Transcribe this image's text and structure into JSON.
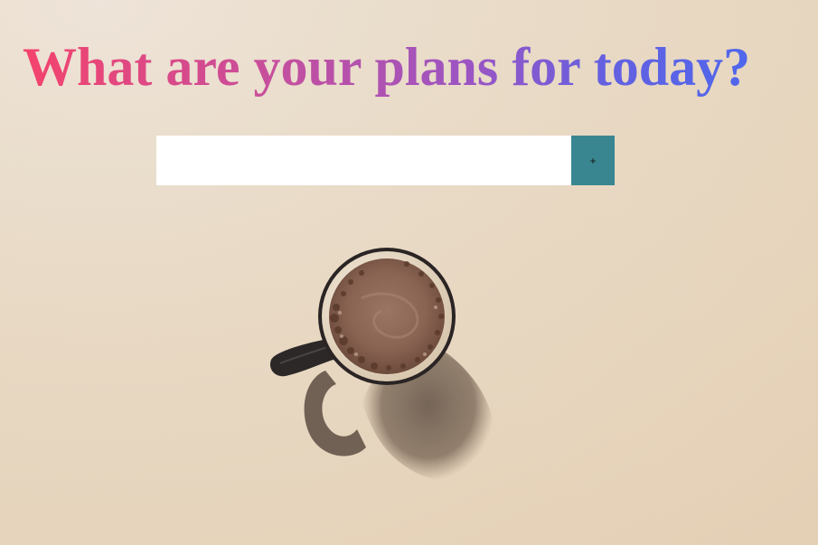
{
  "header": {
    "title": "What are your plans for today?"
  },
  "todo_form": {
    "input_value": "",
    "input_placeholder": "",
    "add_button_label": "+"
  },
  "colors": {
    "title_gradient_start": "#f4436c",
    "title_gradient_mid": "#9a55c4",
    "title_gradient_end": "#4f67ec",
    "add_button_background": "#3a8690",
    "background": "#e8dac6"
  },
  "icons": {
    "background_image": "coffee-cup-icon"
  }
}
